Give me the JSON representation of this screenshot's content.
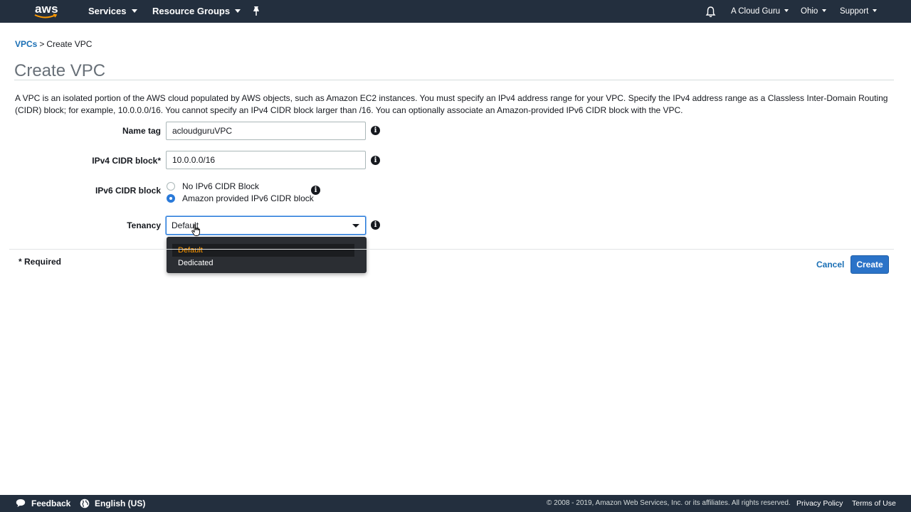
{
  "nav": {
    "logo_text": "aws",
    "services_label": "Services",
    "resource_groups_label": "Resource Groups",
    "account_label": "A Cloud Guru",
    "region_label": "Ohio",
    "support_label": "Support"
  },
  "breadcrumb": {
    "parent": "VPCs",
    "separator": ">",
    "current": "Create VPC"
  },
  "page": {
    "title": "Create VPC",
    "description": "A VPC is an isolated portion of the AWS cloud populated by AWS objects, such as Amazon EC2 instances. You must specify an IPv4 address range for your VPC. Specify the IPv4 address range as a Classless Inter-Domain Routing (CIDR) block; for example, 10.0.0.0/16. You cannot specify an IPv4 CIDR block larger than /16. You can optionally associate an Amazon-provided IPv6 CIDR block with the VPC."
  },
  "form": {
    "name_tag": {
      "label": "Name tag",
      "value": "acloudguruVPC"
    },
    "ipv4_cidr": {
      "label": "IPv4 CIDR block*",
      "value": "10.0.0.0/16"
    },
    "ipv6_cidr": {
      "label": "IPv6 CIDR block",
      "options": [
        "No IPv6 CIDR Block",
        "Amazon provided IPv6 CIDR block"
      ],
      "selected": "Amazon provided IPv6 CIDR block"
    },
    "tenancy": {
      "label": "Tenancy",
      "value": "Default",
      "options": [
        "Default",
        "Dedicated"
      ],
      "highlighted": "Default"
    },
    "required_note": "* Required",
    "cancel_label": "Cancel",
    "create_label": "Create"
  },
  "footer": {
    "feedback_label": "Feedback",
    "language_label": "English (US)",
    "copyright": "© 2008 - 2019, Amazon Web Services, Inc. or its affiliates. All rights reserved.",
    "privacy_label": "Privacy Policy",
    "terms_label": "Terms of Use"
  },
  "colors": {
    "nav_bg": "#232f3e",
    "link": "#1a6fb5",
    "primary_button": "#2b73c8",
    "dropdown_highlight": "#ff9900",
    "radio_selected": "#2a7ad9"
  },
  "icons": [
    "aws-logo",
    "chevron-down-icon",
    "pin-icon",
    "bell-icon",
    "info-icon",
    "hand-cursor-icon",
    "feedback-icon",
    "globe-icon"
  ]
}
